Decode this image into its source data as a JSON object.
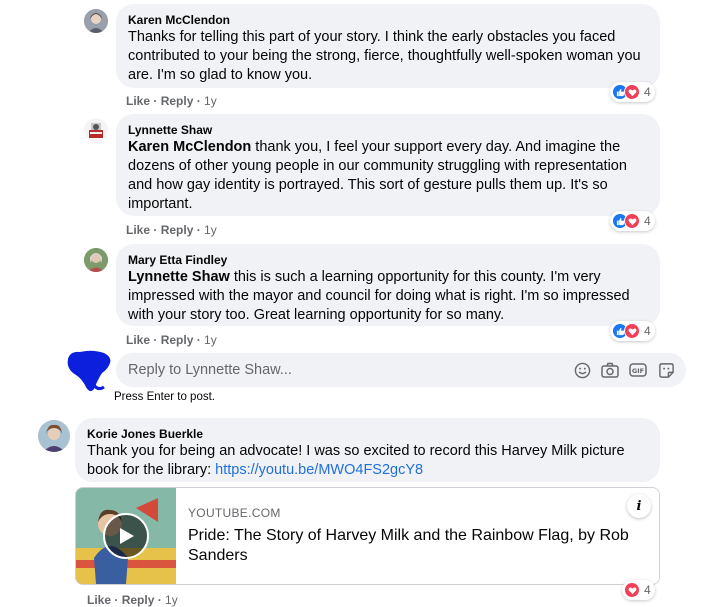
{
  "comments": [
    {
      "author": "Karen McClendon",
      "mention": "",
      "text": "Thanks for telling this part of your story. I think the early obstacles you faced contributed to your being the strong, fierce, thoughtfully well-spoken woman you are. I'm so glad to know you.",
      "actions": {
        "like": "Like",
        "reply": "Reply",
        "time": "1y"
      },
      "reaction_count": "4"
    },
    {
      "author": "Lynnette Shaw",
      "mention": "Karen McClendon",
      "text": " thank you, I feel your support every day. And imagine the dozens of other young people in our community struggling with representation and how gay identity is portrayed. This sort of gesture pulls them up. It's so important.",
      "actions": {
        "like": "Like",
        "reply": "Reply",
        "time": "1y"
      },
      "reaction_count": "4"
    },
    {
      "author": "Mary Etta Findley",
      "mention": "Lynnette Shaw",
      "text": " this is such a learning opportunity for this county. I'm very impressed with the mayor and council for doing what is right. I'm so impressed with your story too. Great learning opportunity for so many.",
      "actions": {
        "like": "Like",
        "reply": "Reply",
        "time": "1y"
      },
      "reaction_count": "4"
    },
    {
      "author": "Korie Jones Buerkle",
      "mention": "",
      "text": "Thank you for being an advocate! I was so excited to record this Harvey Milk picture book for the library: ",
      "link": "https://youtu.be/MWO4FS2gcY8",
      "actions": {
        "like": "Like",
        "reply": "Reply",
        "time": "1y"
      },
      "reaction_count": "4"
    }
  ],
  "reply_box": {
    "placeholder": "Reply to Lynnette Shaw...",
    "hint": "Press Enter to post.",
    "icons": [
      "emoji-icon",
      "camera-icon",
      "gif-icon",
      "sticker-icon"
    ]
  },
  "link_preview": {
    "domain": "YOUTUBE.COM",
    "title": "Pride: The Story of Harvey Milk and the Rainbow Flag, by Rob Sanders"
  },
  "colors": {
    "like": "#1877f2",
    "love": "#f33e58",
    "link": "#216fdb",
    "bubble": "#f0f2f5",
    "annotation": "#0b1fdd"
  }
}
